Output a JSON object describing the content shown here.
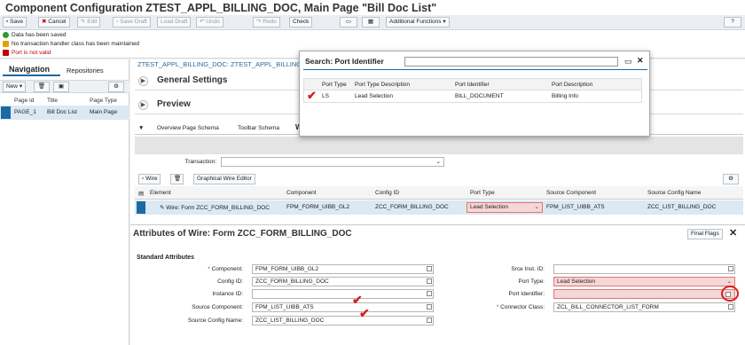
{
  "title": "Component Configuration ZTEST_APPL_BILLING_DOC, Main Page \"Bill Doc List\"",
  "toolbar": {
    "save": "Save",
    "cancel": "Cancel",
    "edit": "Edit",
    "save_draft": "Save Draft",
    "load_draft": "Load Draft",
    "undo": "Undo",
    "redo": "Redo",
    "check": "Check",
    "additional": "Additional Functions"
  },
  "messages": [
    {
      "text": "Data has been saved",
      "type": "success"
    },
    {
      "text": "No transaction handler class has been maintained",
      "type": "warning"
    },
    {
      "text": "Port is not valid",
      "type": "error"
    }
  ],
  "nav": {
    "tab_active": "Navigation",
    "tab_other": "Repositories",
    "new": "New",
    "cols": [
      "Page Id",
      "Title",
      "Page Type"
    ],
    "row": [
      "PAGE_1",
      "Bill Doc List",
      "Main Page"
    ]
  },
  "breadcrumb": "ZTEST_APPL_BILLING_DOC: ZTEST_APPL_BILLING_DOC",
  "panels": {
    "general": "General Settings",
    "preview": "Preview"
  },
  "tabs": {
    "overview": "Overview Page Schema",
    "toolbar": "Toolbar Schema",
    "wire": "W"
  },
  "transaction_label": "Transaction:",
  "wire_toolbar": {
    "wire": "Wire",
    "editor": "Graphical Wire Editor"
  },
  "wire_table": {
    "cols": [
      "Element",
      "Component",
      "Config ID",
      "Port Type",
      "Source Component",
      "Source Config Name"
    ],
    "row": [
      "Wire: Form ZCC_FORM_BILLING_DOC",
      "FPM_FORM_UIBB_GL2",
      "ZCC_FORM_BILLING_DOC",
      "Lead Selection",
      "FPM_LIST_UIBB_ATS",
      "ZCC_LIST_BILLING_DOC"
    ]
  },
  "attributes": {
    "title": "Attributes of Wire: Form ZCC_FORM_BILLING_DOC",
    "final_flags": "Final Flags",
    "section": "Standard Attributes",
    "component_lbl": "Component:",
    "component": "FPM_FORM_UIBB_GL2",
    "configid_lbl": "Config ID:",
    "configid": "ZCC_FORM_BILLING_DOC",
    "instance_lbl": "Instance ID:",
    "instance": "",
    "srccomp_lbl": "Source Component:",
    "srccomp": "FPM_LIST_UIBB_ATS",
    "srccfg_lbl": "Source Config Name:",
    "srccfg": "ZCC_LIST_BILLING_DOC",
    "srceinst_lbl": "Srce Inst. ID:",
    "srceinst": "",
    "porttype_lbl": "Port Type:",
    "porttype": "Lead Selection",
    "portid_lbl": "Port Identifier:",
    "portid": "",
    "connector_lbl": "Connector Class:",
    "connector": "ZCL_BILL_CONNECTOR_LIST_FORM"
  },
  "dialog": {
    "title": "Search: Port Identifier",
    "cols": [
      "Port Type",
      "Port Type Description",
      "Port Identifier",
      "Port Description"
    ],
    "row": [
      "LS",
      "Lead Selection",
      "BILL_DOCUMENT",
      "Billing Info"
    ]
  },
  "colors": {
    "accent": "#1b6aa3",
    "error": "#c00000",
    "success": "#2e9b2e",
    "warning": "#e5a000",
    "annotation": "#d42020"
  }
}
